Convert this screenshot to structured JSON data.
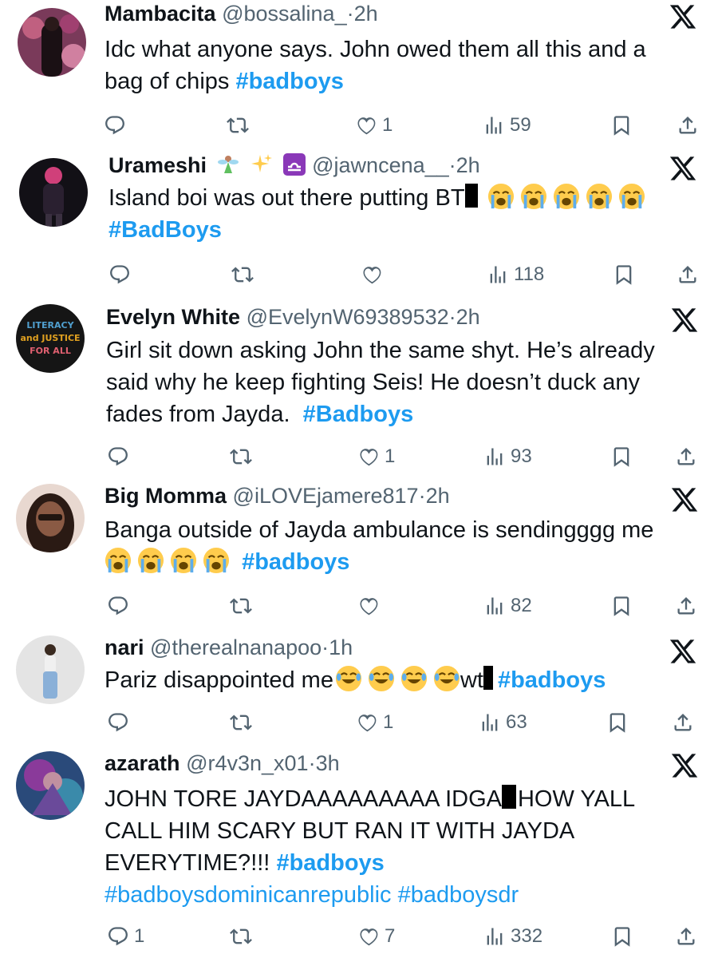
{
  "tweets": [
    {
      "name": "Mambacita",
      "handle": "@bossalina_",
      "time": "2h",
      "body": "Idc what anyone says. John owed them all this and a",
      "body2": "bag of chips",
      "tags": [
        "#badboys"
      ],
      "replies": "",
      "likes": "1",
      "views": "59",
      "avatar_color": "#8a4a6a"
    },
    {
      "name": "Urameshi",
      "name_icons": [
        "fairy-icon",
        "sparkles-icon",
        "libra-icon"
      ],
      "handle": "@jawncena__",
      "time": "2h",
      "body": "Island boi was out there putting BT",
      "tags": [
        "#BadBoys"
      ],
      "replies": "",
      "likes": "",
      "views": "118",
      "avatar_color": "#3a2a4a"
    },
    {
      "name": "Evelyn White",
      "handle": "@EvelynW69389532",
      "time": "2h",
      "body_lines": [
        "Girl sit down asking John the same shyt. He’s already",
        "said why he keep fighting Seis! He doesn’t duck any",
        "fades from Jayda."
      ],
      "tags": [
        "#Badboys"
      ],
      "replies": "",
      "likes": "1",
      "views": "93",
      "avatar_lines": [
        "LITERACY",
        "and JUSTICE",
        "FOR ALL"
      ]
    },
    {
      "name": "Big Momma",
      "handle": "@iLOVEjamere817",
      "time": "2h",
      "body": "Banga outside of Jayda ambulance is sendingggg me",
      "tags": [
        "#badboys"
      ],
      "replies": "",
      "likes": "",
      "views": "82",
      "avatar_color": "#a0705a"
    },
    {
      "name": "nari",
      "handle": "@therealnanapoo",
      "time": "1h",
      "body": "Pariz disappointed me",
      "body_after": "wt",
      "tags": [
        "#badboys"
      ],
      "replies": "",
      "likes": "1",
      "views": "63",
      "avatar_color": "#d8d8d8"
    },
    {
      "name": "azarath",
      "handle": "@r4v3n_x01",
      "time": "3h",
      "body_lines": [
        "JOHN TORE JAYDAAAAAAAAA IDGA",
        "HOW YALL",
        "CALL HIM SCARY BUT RAN IT WITH JAYDA",
        "EVERYTIME?!!!"
      ],
      "tags": [
        "#badboys",
        "#badboysdominicanrepublic",
        "#badboysdr"
      ],
      "replies": "1",
      "likes": "7",
      "views": "332",
      "avatar_color": "#4a3a7a"
    }
  ],
  "ui": {
    "dot": "·",
    "accent": "#1d9bf0",
    "muted": "#536471"
  }
}
